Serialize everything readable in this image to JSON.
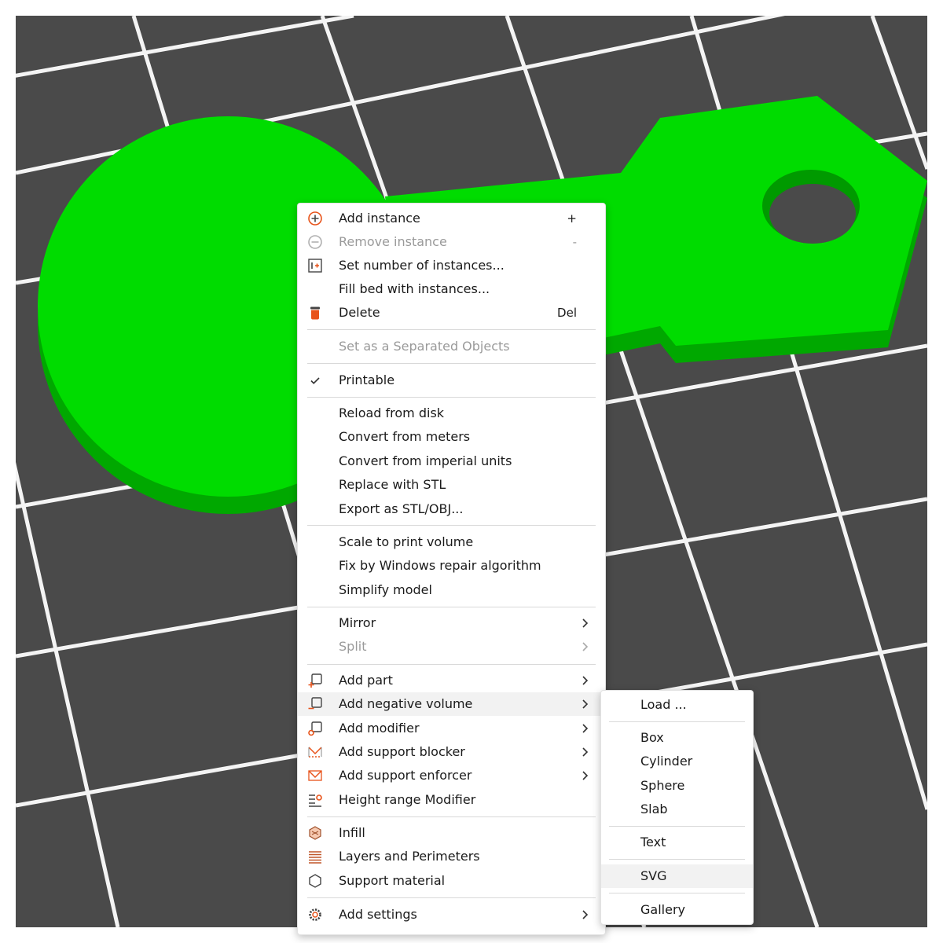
{
  "colors": {
    "bed": "#4a4a4a",
    "grid": "#f4f4f4",
    "model_top": "#00dc00",
    "model_side": "#00a800",
    "menu_bg": "#ffffff",
    "separator": "#d9d9d9",
    "accent": "#e8531a"
  },
  "context_menu": {
    "add_instance": {
      "label": "Add instance",
      "shortcut": "+",
      "icon": "plus-circle-icon"
    },
    "remove_instance": {
      "label": "Remove instance",
      "shortcut": "-",
      "icon": "minus-circle-icon"
    },
    "set_number_instances": {
      "label": "Set number of instances...",
      "icon": "instances-number-icon"
    },
    "fill_bed": {
      "label": "Fill bed with instances..."
    },
    "delete": {
      "label": "Delete",
      "shortcut": "Del",
      "icon": "trash-icon"
    },
    "set_separated": {
      "label": "Set as a Separated Objects"
    },
    "printable": {
      "label": "Printable",
      "checked": true,
      "icon": "checkmark-icon"
    },
    "reload_from_disk": {
      "label": "Reload from disk"
    },
    "convert_from_meters": {
      "label": "Convert from meters"
    },
    "convert_from_imperial": {
      "label": "Convert from imperial units"
    },
    "replace_with_stl": {
      "label": "Replace with STL"
    },
    "export_as_stl": {
      "label": "Export as STL/OBJ..."
    },
    "scale_to_volume": {
      "label": "Scale to print volume"
    },
    "fix_windows_repair": {
      "label": "Fix by Windows repair algorithm"
    },
    "simplify_model": {
      "label": "Simplify model"
    },
    "mirror": {
      "label": "Mirror"
    },
    "split": {
      "label": "Split"
    },
    "add_part": {
      "label": "Add part",
      "icon": "add-part-icon"
    },
    "add_negative_volume": {
      "label": "Add negative volume",
      "icon": "add-negative-volume-icon"
    },
    "add_modifier": {
      "label": "Add modifier",
      "icon": "add-modifier-icon"
    },
    "add_support_blocker": {
      "label": "Add support blocker",
      "icon": "support-blocker-icon"
    },
    "add_support_enforcer": {
      "label": "Add support enforcer",
      "icon": "support-enforcer-icon"
    },
    "height_range_modifier": {
      "label": "Height range Modifier",
      "icon": "height-range-icon"
    },
    "infill": {
      "label": "Infill",
      "icon": "infill-icon"
    },
    "layers_perimeters": {
      "label": "Layers and Perimeters",
      "icon": "layers-icon"
    },
    "support_material": {
      "label": "Support material",
      "icon": "support-material-icon"
    },
    "add_settings": {
      "label": "Add settings",
      "icon": "settings-gear-icon"
    }
  },
  "submenu": {
    "load": "Load ...",
    "box": "Box",
    "cylinder": "Cylinder",
    "sphere": "Sphere",
    "slab": "Slab",
    "text": "Text",
    "svg": "SVG",
    "gallery": "Gallery"
  }
}
